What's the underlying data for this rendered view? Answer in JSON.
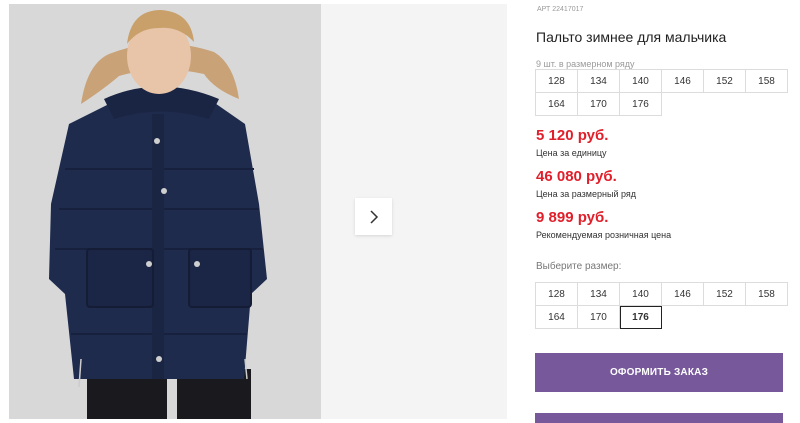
{
  "product": {
    "sku": "АРТ 22417017",
    "title": "Пальто зимнее для мальчика",
    "row_count": "9 шт. в размерном ряду",
    "row_sizes": [
      "128",
      "134",
      "140",
      "146",
      "152",
      "158",
      "164",
      "170",
      "176"
    ]
  },
  "prices": {
    "unit_price": "5 120 руб.",
    "unit_note": "Цена за единицу",
    "row_price": "46 080 руб.",
    "row_note": "Цена за размерный ряд",
    "retail_price": "9 899 руб.",
    "retail_note": "Рекомендуемая розничная цена"
  },
  "size_select": {
    "label": "Выберите размер:",
    "options": [
      "128",
      "134",
      "140",
      "146",
      "152",
      "158",
      "164",
      "170",
      "176"
    ],
    "selected": "176"
  },
  "actions": {
    "order_label": "ОФОРМИТЬ ЗАКАЗ"
  },
  "colors": {
    "price": "#e11f2b",
    "order_button": "#76589b",
    "jacket": "#1f2b4d",
    "fur": "#c9a277"
  }
}
